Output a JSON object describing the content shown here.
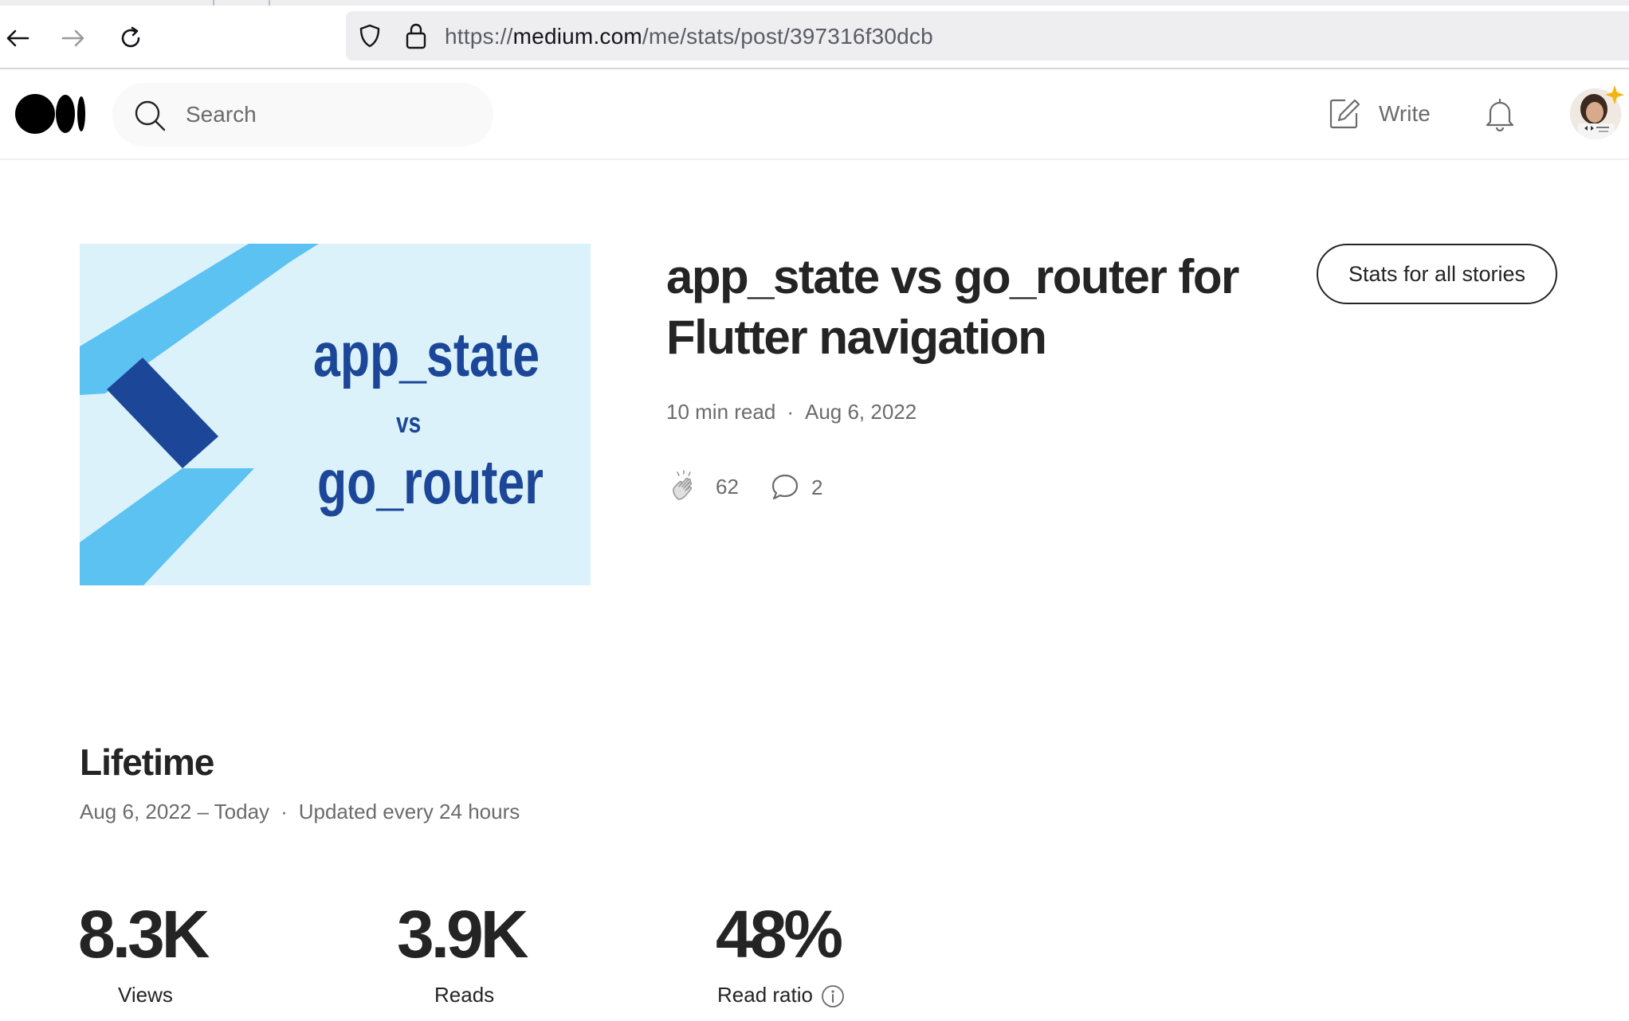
{
  "browser": {
    "url_scheme": "https://",
    "url_host": "medium.com",
    "url_path": "/me/stats/post/397316f30dcb"
  },
  "header": {
    "search_placeholder": "Search",
    "write_label": "Write"
  },
  "story": {
    "title": "app_state vs go_router for Flutter navigation",
    "read_time": "10 min read",
    "date": "Aug 6, 2022",
    "claps": "62",
    "responses": "2",
    "stats_all_label": "Stats for all stories",
    "thumbnail": {
      "line1": "app_state",
      "line2": "vs",
      "line3": "go_router",
      "bg_color": "#dcf2fb",
      "light_chevron": "#5bc2f2",
      "dark_chevron": "#1c4698"
    }
  },
  "lifetime": {
    "title": "Lifetime",
    "range": "Aug 6, 2022 – Today",
    "update_note": "Updated every 24 hours",
    "views_value": "8.3K",
    "views_label": "Views",
    "reads_value": "3.9K",
    "reads_label": "Reads",
    "ratio_value": "48%",
    "ratio_label": "Read ratio"
  },
  "icons": [
    "back-arrow-icon",
    "forward-arrow-icon",
    "reload-icon",
    "shield-icon",
    "lock-icon",
    "medium-logo",
    "search-icon",
    "write-icon",
    "bell-icon",
    "clap-icon",
    "comment-icon",
    "info-icon"
  ]
}
